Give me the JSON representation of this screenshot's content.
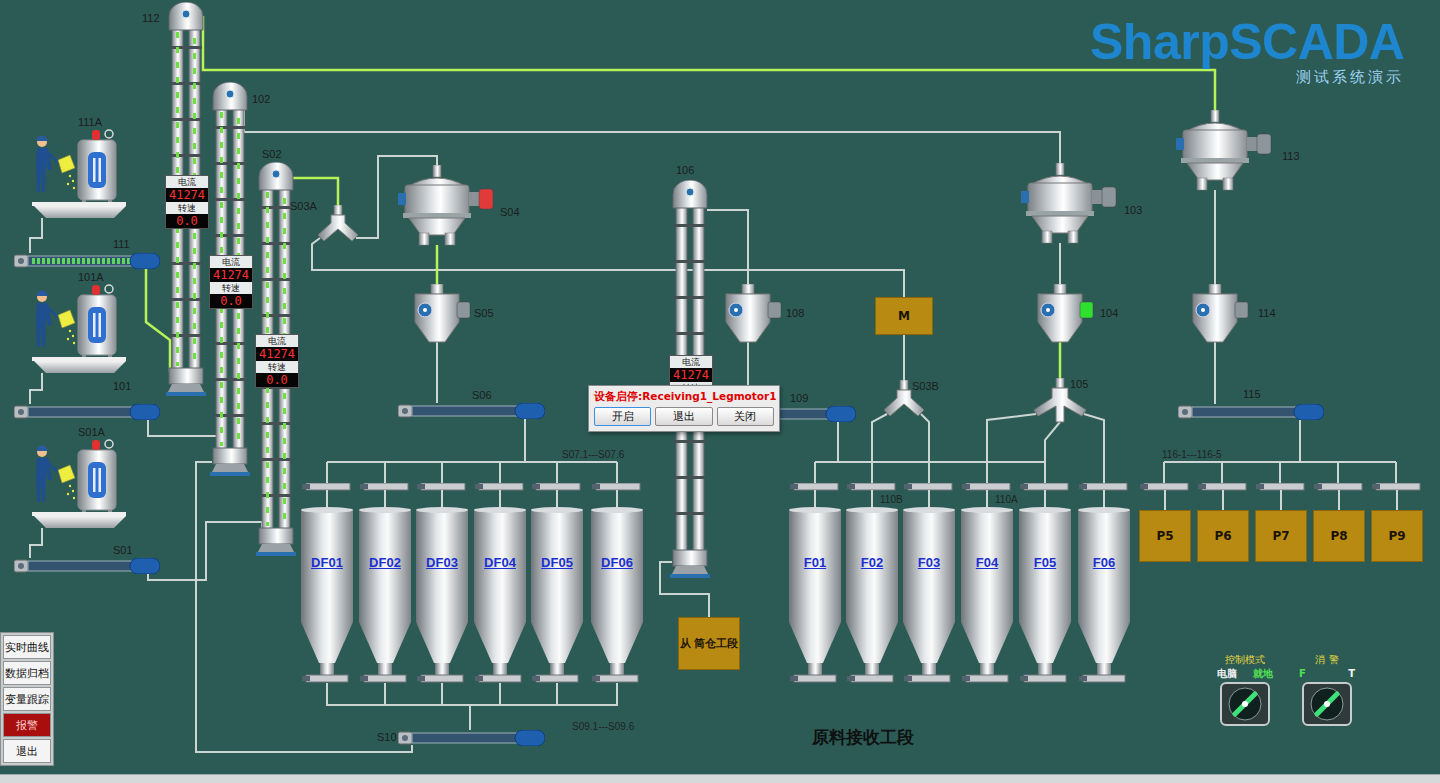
{
  "logo": {
    "title": "SharpSCADA",
    "subtitle": "测试系统演示"
  },
  "section_title": "原料接收工段",
  "elevators": [
    {
      "label": "112",
      "current_label": "电流",
      "current": "41274",
      "speed_label": "转速",
      "speed": "0.0",
      "running": true
    },
    {
      "label": "102",
      "current_label": "电流",
      "current": "41274",
      "speed_label": "转速",
      "speed": "0.0",
      "running": true
    },
    {
      "label": "S02",
      "current_label": "电流",
      "current": "41274",
      "speed_label": "转速",
      "speed": "0.0",
      "running": true
    },
    {
      "label": "106",
      "current_label": "电流",
      "current": "41274",
      "speed_label": "转速",
      "running": false
    }
  ],
  "tanks": [
    {
      "label": "111A"
    },
    {
      "label": "101A"
    },
    {
      "label": "S01A"
    }
  ],
  "conveyors": [
    {
      "label": "111",
      "running": true
    },
    {
      "label": "101",
      "running": false
    },
    {
      "label": "S01",
      "running": false
    },
    {
      "label": "S06",
      "running": false
    },
    {
      "label": "109",
      "running": false
    },
    {
      "label": "115",
      "running": false
    },
    {
      "label": "S10",
      "running": false
    }
  ],
  "separators": [
    {
      "label": "S04",
      "motor_state": "fault"
    },
    {
      "label": "103",
      "motor_state": "stopped"
    },
    {
      "label": "113",
      "motor_state": "stopped"
    }
  ],
  "feeders": [
    {
      "label": "S05",
      "motor_state": "stopped"
    },
    {
      "label": "108",
      "motor_state": "stopped"
    },
    {
      "label": "104",
      "motor_state": "running"
    },
    {
      "label": "114",
      "motor_state": "stopped"
    }
  ],
  "diverters": [
    {
      "label": "S03A",
      "kind": "two-way"
    },
    {
      "label": "S03B",
      "kind": "two-way"
    },
    {
      "label": "105",
      "kind": "three-way"
    }
  ],
  "boxes": [
    {
      "label": "M"
    },
    {
      "label": "从 筒仓工段"
    }
  ],
  "silos": [
    {
      "label": "DF01"
    },
    {
      "label": "DF02"
    },
    {
      "label": "DF03"
    },
    {
      "label": "DF04"
    },
    {
      "label": "DF05"
    },
    {
      "label": "DF06"
    },
    {
      "label": "F01"
    },
    {
      "label": "F02"
    },
    {
      "label": "F03"
    },
    {
      "label": "F04"
    },
    {
      "label": "F05"
    },
    {
      "label": "F06"
    }
  ],
  "bins": [
    {
      "label": "P5"
    },
    {
      "label": "P6"
    },
    {
      "label": "P7"
    },
    {
      "label": "P8"
    },
    {
      "label": "P9"
    }
  ],
  "notes": [
    "S07.1---S07.6",
    "S09.1---S09.6",
    "110B",
    "110A",
    "116-1---116-5"
  ],
  "pipes": [
    {
      "active": true
    },
    {
      "active": false
    },
    {
      "active": true
    },
    {
      "active": false
    },
    {
      "active": false
    },
    {
      "active": false
    },
    {
      "active": true
    },
    {
      "active": false
    },
    {
      "active": false
    },
    {
      "active": false
    },
    {
      "active": false
    },
    {
      "active": true
    },
    {
      "active": false
    },
    {
      "active": false
    },
    {
      "active": false
    },
    {
      "active": false
    },
    {
      "active": false
    },
    {
      "active": false
    },
    {
      "active": false
    },
    {
      "active": false
    },
    {
      "active": false
    },
    {
      "active": false
    },
    {
      "active": false
    },
    {
      "active": true
    },
    {
      "active": false
    },
    {
      "active": false
    },
    {
      "active": false
    },
    {
      "active": false
    }
  ],
  "menu": [
    {
      "label": "实时曲线",
      "alarm": false
    },
    {
      "label": "数据归档",
      "alarm": false
    },
    {
      "label": "变量跟踪",
      "alarm": false
    },
    {
      "label": "报警",
      "alarm": true
    },
    {
      "label": "退出",
      "alarm": false
    }
  ],
  "switches": [
    {
      "title": "控制模式",
      "options": [
        {
          "label": "电脑",
          "selected": false
        },
        {
          "label": "就地",
          "selected": true
        }
      ]
    },
    {
      "title": "消 警",
      "options": [
        {
          "label": "F",
          "selected": true
        },
        {
          "label": "T",
          "selected": false
        }
      ]
    }
  ],
  "dialog": {
    "title": "设备启停:Receiving1_Legmotor1",
    "buttons": [
      {
        "label": "开启",
        "selected": true
      },
      {
        "label": "退出",
        "selected": false
      },
      {
        "label": "关闭",
        "selected": false
      }
    ]
  }
}
